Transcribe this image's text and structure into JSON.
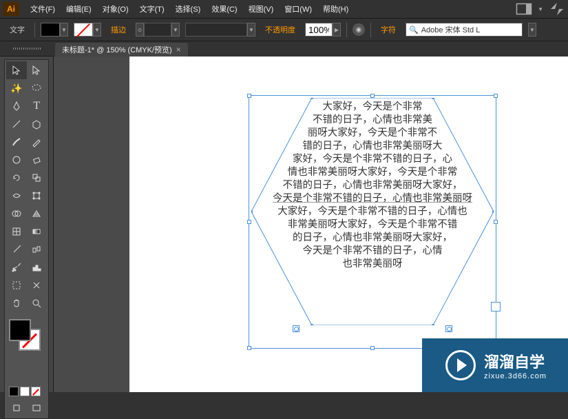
{
  "app": {
    "name": "Adobe Illustrator",
    "icon_label": "Ai"
  },
  "menubar": {
    "items": [
      "文件(F)",
      "编辑(E)",
      "对象(O)",
      "文字(T)",
      "选择(S)",
      "效果(C)",
      "视图(V)",
      "窗口(W)",
      "帮助(H)"
    ]
  },
  "optionsbar": {
    "tool_label": "文字",
    "stroke_label": "描边",
    "stroke_value": "",
    "opacity_label": "不透明度",
    "opacity_value": "100%",
    "char_label": "字符",
    "font_search_placeholder": "Adobe 宋体 Std L"
  },
  "tab": {
    "title": "未标题-1* @ 150% (CMYK/预览)"
  },
  "tools": [
    [
      "selection",
      "direct-selection"
    ],
    [
      "magic-wand",
      "lasso"
    ],
    [
      "pen",
      "type"
    ],
    [
      "line-segment",
      "rectangle"
    ],
    [
      "paintbrush",
      "pencil"
    ],
    [
      "blob-brush",
      "eraser"
    ],
    [
      "rotate",
      "scale"
    ],
    [
      "width",
      "free-transform"
    ],
    [
      "shape-builder",
      "perspective-grid"
    ],
    [
      "mesh",
      "gradient"
    ],
    [
      "eyedropper",
      "blend"
    ],
    [
      "symbol-sprayer",
      "column-graph"
    ],
    [
      "artboard",
      "slice"
    ],
    [
      "hand",
      "zoom"
    ]
  ],
  "bottom_tools": [
    "draw-normal",
    "draw-behind",
    "draw-inside"
  ],
  "screen_modes": [
    "change-screen",
    "full-screen"
  ],
  "canvas": {
    "text_content": "大家好，今天是个非常\n不错的日子，心情也非常美\n丽呀大家好，今天是个非常不\n错的日子，心情也非常美丽呀大\n家好，今天是个非常不错的日子，心\n情也非常美丽呀大家好，今天是个非常\n不错的日子，心情也非常美丽呀大家好，\n今天是个非常不错的日子，心情也非常美丽呀\n大家好，今天是个非常不错的日子，心情也\n非常美丽呀大家好，今天是个非常不错\n的日子，心情也非常美丽呀大家好，\n今天是个非常不错的日子，心情\n也非常美丽呀"
  },
  "watermark": {
    "title": "溜溜自学",
    "url": "zixue.3d66.com"
  }
}
